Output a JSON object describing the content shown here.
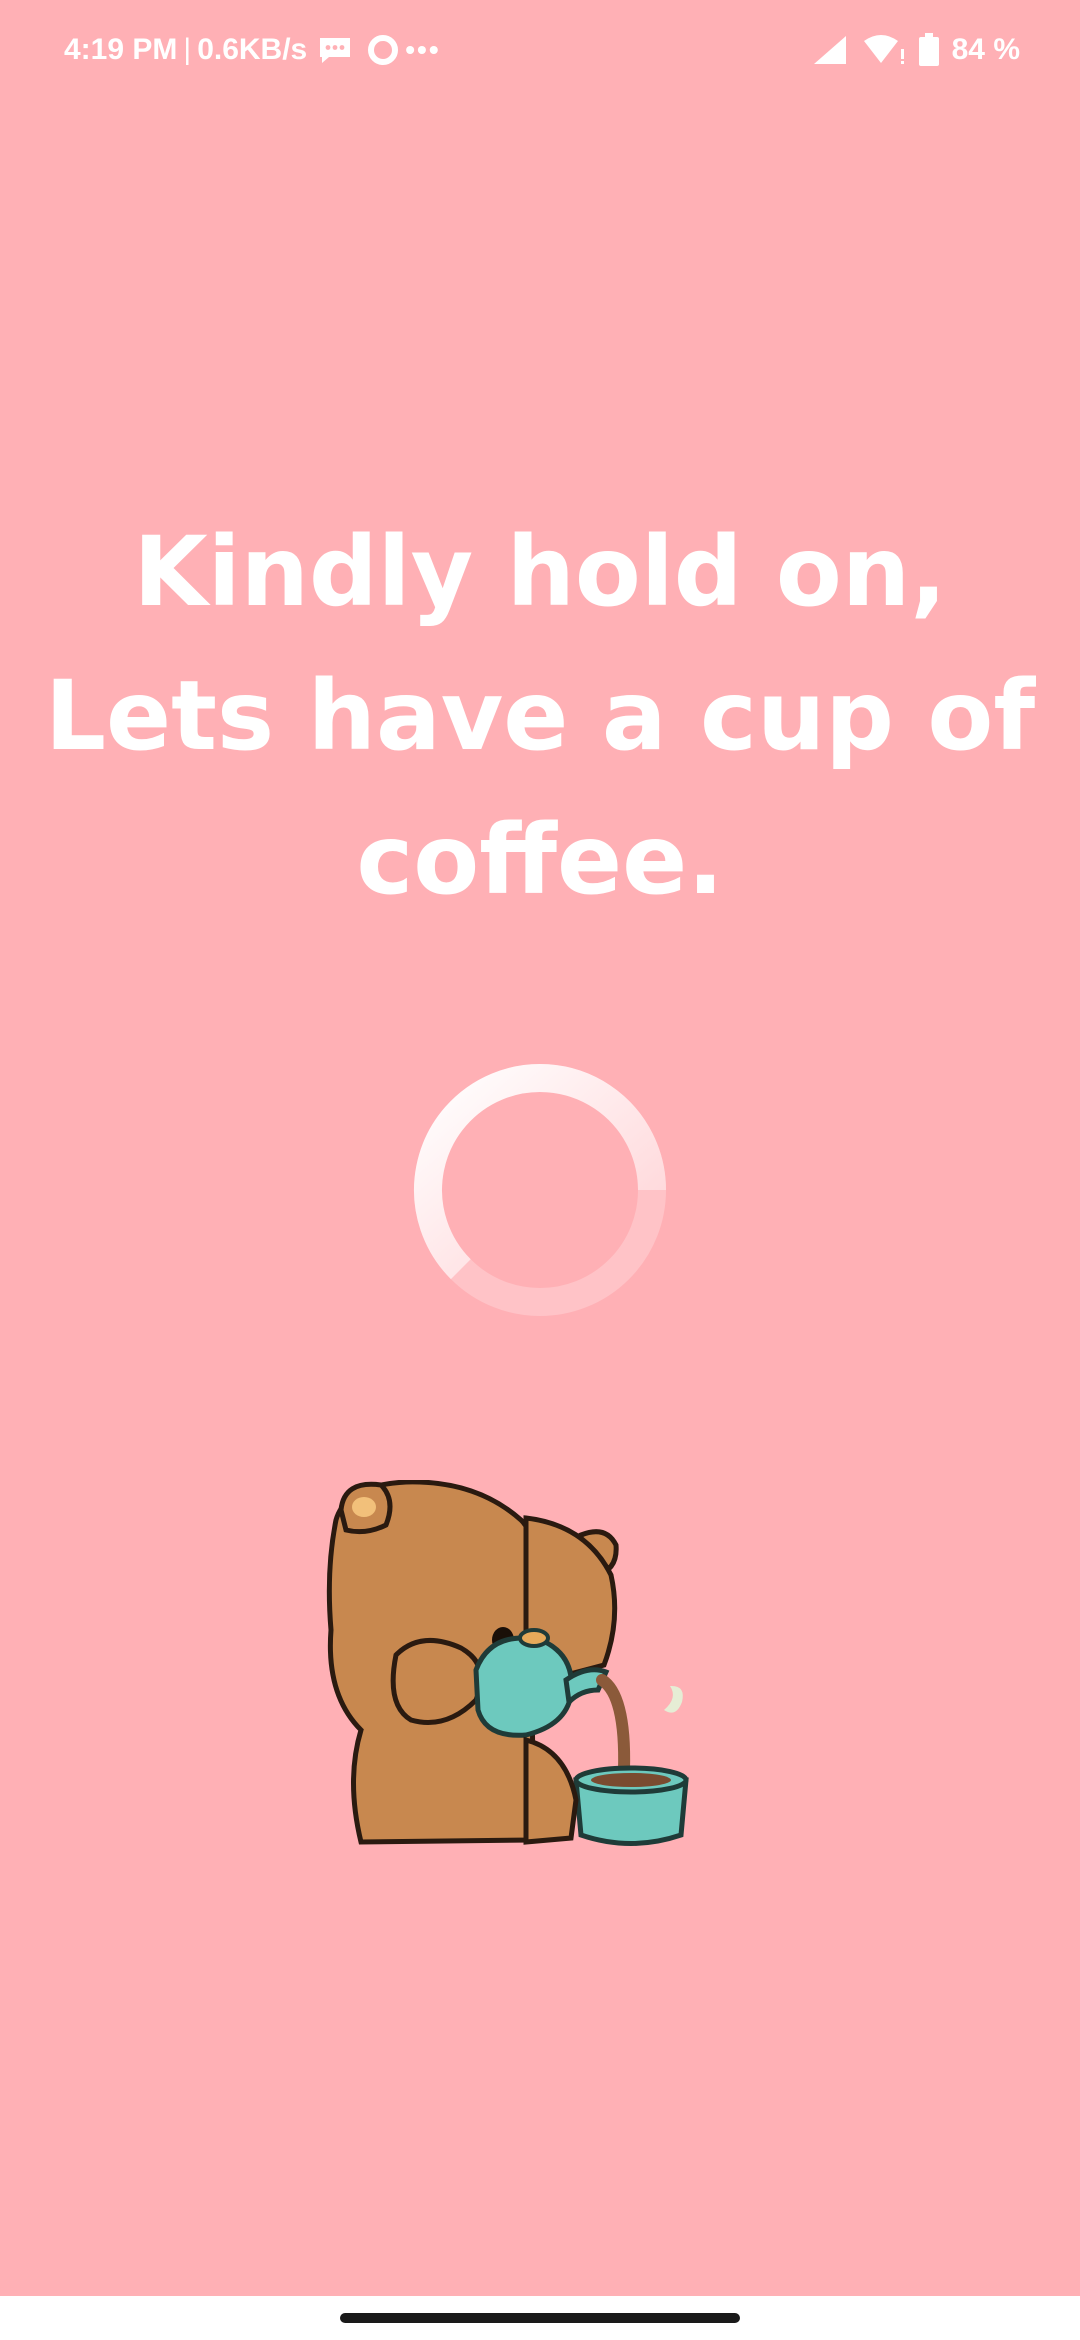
{
  "status_bar": {
    "time": "4:19 PM",
    "separator": "|",
    "net_speed": "0.6KB/s",
    "overflow": "•••",
    "battery": "84 %",
    "icons": [
      "message-icon",
      "ring-icon",
      "signal-icon",
      "wifi-icon",
      "battery-icon"
    ]
  },
  "headline": {
    "line1": "Kindly hold on,",
    "line2": "Lets have a cup of",
    "line3": "coffee."
  },
  "colors": {
    "background": "#FFB0B5",
    "text": "#FFFFFF",
    "spinner_track": "#FFC3C7",
    "spinner_arc": "#FFFFFF",
    "bear_fur": "#C8884F",
    "cup": "#6DC9BE"
  },
  "illustration": {
    "icon": "bear-drinking-coffee-icon"
  }
}
